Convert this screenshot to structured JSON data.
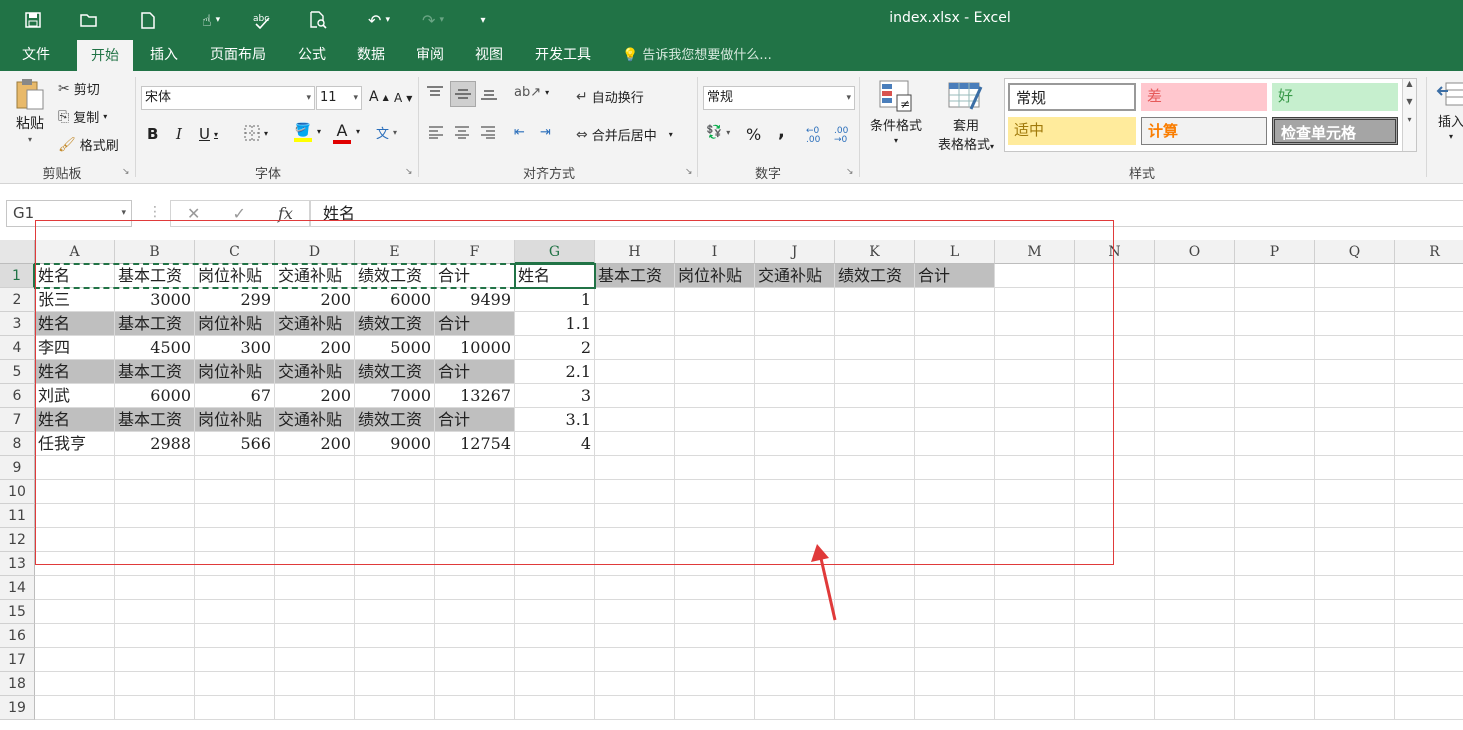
{
  "window": {
    "title": "index.xlsx  -  Excel"
  },
  "quick_access": [
    "save-icon",
    "open-icon",
    "new-icon",
    "touch-icon",
    "spellcheck-icon",
    "print-preview-icon",
    "undo-icon",
    "redo-icon",
    "customize-icon"
  ],
  "tabs": [
    {
      "label": "文件"
    },
    {
      "label": "开始"
    },
    {
      "label": "插入"
    },
    {
      "label": "页面布局"
    },
    {
      "label": "公式"
    },
    {
      "label": "数据"
    },
    {
      "label": "审阅"
    },
    {
      "label": "视图"
    },
    {
      "label": "开发工具"
    }
  ],
  "tell_me": "告诉我您想要做什么...",
  "clipboard": {
    "paste": "粘贴",
    "cut": "剪切",
    "copy": "复制",
    "format_painter": "格式刷",
    "label": "剪贴板"
  },
  "font": {
    "name": "宋体",
    "size": "11",
    "label": "字体",
    "bold": "B",
    "italic": "I",
    "underline": "U",
    "font_color": "A",
    "grow": "A",
    "shrink": "A"
  },
  "alignment": {
    "wrap": "自动换行",
    "merge": "合并后居中",
    "label": "对齐方式"
  },
  "number": {
    "format": "常规",
    "label": "数字",
    "percent": "%",
    "comma": ","
  },
  "styles": {
    "conditional": "条件格式",
    "table_format_1": "套用",
    "table_format_2": "表格格式",
    "label": "样式",
    "gallery": [
      "常规",
      "差",
      "好",
      "适中",
      "计算",
      "检查单元格"
    ],
    "colors": {
      "bad_bg": "#ffc7ce",
      "good_bg": "#c6efce",
      "neutral_bg": "#ffeb9c",
      "check_bg": "#a5a5a5"
    }
  },
  "cells_group": {
    "insert": "插入"
  },
  "formula_bar": {
    "name_box": "G1",
    "cancel": "✕",
    "enter": "✓",
    "fx": "fx",
    "content": "姓名"
  },
  "columns": [
    "A",
    "B",
    "C",
    "D",
    "E",
    "F",
    "G",
    "H",
    "I",
    "J",
    "K",
    "L",
    "M",
    "N",
    "O",
    "P",
    "Q",
    "R"
  ],
  "rows": [
    "1",
    "2",
    "3",
    "4",
    "5",
    "6",
    "7",
    "8",
    "9",
    "10",
    "11",
    "12",
    "13",
    "14",
    "15",
    "16",
    "17",
    "18",
    "19"
  ],
  "sheet": [
    [
      "姓名",
      "基本工资",
      "岗位补贴",
      "交通补贴",
      "绩效工资",
      "合计",
      "姓名",
      "基本工资",
      "岗位补贴",
      "交通补贴",
      "绩效工资",
      "合计"
    ],
    [
      "张三",
      "3000",
      "299",
      "200",
      "6000",
      "9499",
      "1"
    ],
    [
      "姓名",
      "基本工资",
      "岗位补贴",
      "交通补贴",
      "绩效工资",
      "合计",
      "1.1"
    ],
    [
      "李四",
      "4500",
      "300",
      "200",
      "5000",
      "10000",
      "2"
    ],
    [
      "姓名",
      "基本工资",
      "岗位补贴",
      "交通补贴",
      "绩效工资",
      "合计",
      "2.1"
    ],
    [
      "刘武",
      "6000",
      "67",
      "200",
      "7000",
      "13267",
      "3"
    ],
    [
      "姓名",
      "基本工资",
      "岗位补贴",
      "交通补贴",
      "绩效工资",
      "合计",
      "3.1"
    ],
    [
      "任我亨",
      "2988",
      "566",
      "200",
      "9000",
      "12754",
      "4"
    ]
  ],
  "colors": {
    "excel_green": "#217346",
    "header_gray": "#bfbfbf",
    "annotation_red": "#e03a3a"
  }
}
